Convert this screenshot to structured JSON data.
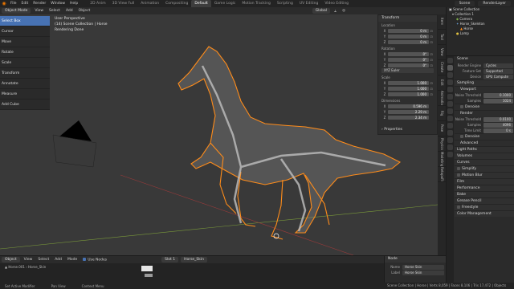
{
  "topbar": {
    "menus": [
      "File",
      "Edit",
      "Render",
      "Window",
      "Help"
    ],
    "workspaces": [
      "2D Anim",
      "3D View Full",
      "Animation",
      "Compositing",
      "Default",
      "Game Logic",
      "Motion Tracking",
      "Scripting",
      "UV Editing",
      "Video Editing"
    ],
    "scene": "Scene",
    "view_layer": "RenderLayer"
  },
  "viewport_header": {
    "mode": "Object Mode",
    "menus": [
      "View",
      "Select",
      "Add",
      "Object"
    ],
    "orientation": "Global"
  },
  "viewport": {
    "info_lines": [
      "User Perspective",
      "(14) Scene Collection | Horse",
      "Rendering Done"
    ],
    "left_list": [
      "Select Box",
      "Cursor",
      "Move",
      "Rotate",
      "Scale",
      "Transform",
      "Annotate",
      "Measure",
      "Add Cube"
    ]
  },
  "npanel": {
    "title": "Transform",
    "location_label": "Location",
    "location": [
      {
        "axis": "X",
        "value": "0 m"
      },
      {
        "axis": "Y",
        "value": "0 m"
      },
      {
        "axis": "Z",
        "value": "0 m"
      }
    ],
    "rotation_label": "Rotation",
    "rotation": [
      {
        "axis": "X",
        "value": "0°"
      },
      {
        "axis": "Y",
        "value": "0°"
      },
      {
        "axis": "Z",
        "value": "0°"
      }
    ],
    "rotation_mode": "XYZ Euler",
    "scale_label": "Scale",
    "scale": [
      {
        "axis": "X",
        "value": "1.000"
      },
      {
        "axis": "Y",
        "value": "1.000"
      },
      {
        "axis": "Z",
        "value": "1.000"
      }
    ],
    "dimensions_label": "Dimensions",
    "dimensions": [
      {
        "axis": "X",
        "value": "0.596 m"
      },
      {
        "axis": "Y",
        "value": "2.29 m"
      },
      {
        "axis": "Z",
        "value": "2.34 m"
      }
    ],
    "properties_label": "Properties"
  },
  "side_tabs": [
    "Item",
    "Tool",
    "View",
    "Create",
    "Edit",
    "Animation",
    "Rig",
    "Pose",
    "Physics",
    "Modeling",
    "RetopoFlow"
  ],
  "outliner": {
    "rows": [
      "Scene Collection",
      "Collection 1",
      "Camera",
      "Horse_Skeleton",
      "Horse",
      "Lamp"
    ]
  },
  "properties": {
    "scene": "Scene",
    "render_engine_key": "Render Engine",
    "render_engine": "Cycles",
    "feature_set_key": "Feature Set",
    "feature_set": "Supported",
    "device_key": "Device",
    "device": "GPU Compute",
    "sampling": "Sampling",
    "viewport": "Viewport",
    "noise_threshold_key": "Noise Threshold",
    "noise_threshold": "0.1000",
    "viewport_samples_key": "Samples",
    "viewport_samples": "1024",
    "denoise": "Denoise",
    "render": "Render",
    "render_noise_threshold": "0.0100",
    "render_samples": "4096",
    "time_limit_key": "Time Limit",
    "time_limit": "0 s",
    "advanced": "Advanced",
    "sections": [
      "Light Paths",
      "Volumes",
      "Curves"
    ],
    "simplify": "Simplify",
    "motion_blur": "Motion Blur",
    "more_sections": [
      "Film",
      "Performance",
      "Bake"
    ],
    "grease_pencil": "Grease Pencil",
    "freestyle": "Freestyle",
    "color_management": "Color Management"
  },
  "timeline": {
    "mode": "Object",
    "menus": [
      "View",
      "Select",
      "Add",
      "Mode"
    ],
    "slot": "Slot 1",
    "action": "Horse_Skin",
    "use_nodes": "Use Nodes",
    "breadcrumb": [
      "Horse.001",
      "Horse_Skin"
    ]
  },
  "node_panel": {
    "title": "Node",
    "name_key": "Name",
    "name": "Horse Skin",
    "label_key": "Label",
    "label": "Horse Skin"
  },
  "statusbar": {
    "hints": [
      "Set Active Modifier",
      "Pan View",
      "Context Menu"
    ],
    "right": "Scene Collection | Horse | Verts 8,059 | Faces 8,106 | Tris 17,472 | Objects"
  }
}
